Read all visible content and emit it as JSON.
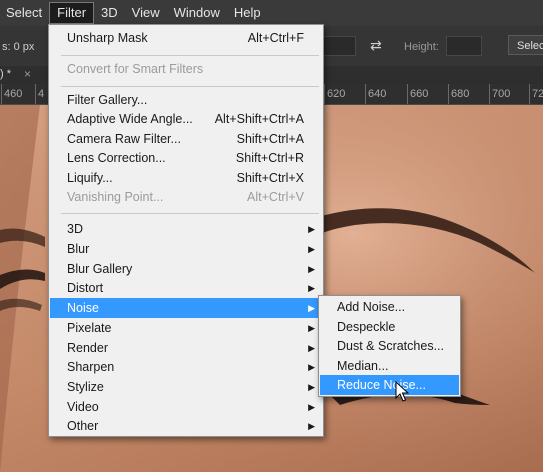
{
  "menubar": {
    "items": [
      {
        "label": "Select"
      },
      {
        "label": "Filter"
      },
      {
        "label": "3D"
      },
      {
        "label": "View"
      },
      {
        "label": "Window"
      },
      {
        "label": "Help"
      }
    ]
  },
  "options": {
    "prefix_label": "s: 0 px",
    "height_label": "Height:",
    "select_label": "Select",
    "swap_icon": "swap-arrows-icon"
  },
  "tab": {
    "label": ") *",
    "close_label": "×"
  },
  "ruler": {
    "ticks": [
      "460",
      "4",
      "620",
      "640",
      "660",
      "680",
      "700",
      "72"
    ]
  },
  "filter_menu": {
    "items": [
      {
        "label": "Unsharp Mask",
        "shortcut": "Alt+Ctrl+F"
      },
      {
        "label": "Convert for Smart Filters"
      },
      {
        "label": "Filter Gallery..."
      },
      {
        "label": "Adaptive Wide Angle...",
        "shortcut": "Alt+Shift+Ctrl+A"
      },
      {
        "label": "Camera Raw Filter...",
        "shortcut": "Shift+Ctrl+A"
      },
      {
        "label": "Lens Correction...",
        "shortcut": "Shift+Ctrl+R"
      },
      {
        "label": "Liquify...",
        "shortcut": "Shift+Ctrl+X"
      },
      {
        "label": "Vanishing Point...",
        "shortcut": "Alt+Ctrl+V"
      },
      {
        "label": "3D"
      },
      {
        "label": "Blur"
      },
      {
        "label": "Blur Gallery"
      },
      {
        "label": "Distort"
      },
      {
        "label": "Noise"
      },
      {
        "label": "Pixelate"
      },
      {
        "label": "Render"
      },
      {
        "label": "Sharpen"
      },
      {
        "label": "Stylize"
      },
      {
        "label": "Video"
      },
      {
        "label": "Other"
      }
    ]
  },
  "noise_submenu": {
    "items": [
      {
        "label": "Add Noise..."
      },
      {
        "label": "Despeckle"
      },
      {
        "label": "Dust & Scratches..."
      },
      {
        "label": "Median..."
      },
      {
        "label": "Reduce Noise..."
      }
    ]
  },
  "colors": {
    "highlight": "#3399ff",
    "menu_bg": "#f0f0f0",
    "app_bg": "#3a3a3a"
  }
}
